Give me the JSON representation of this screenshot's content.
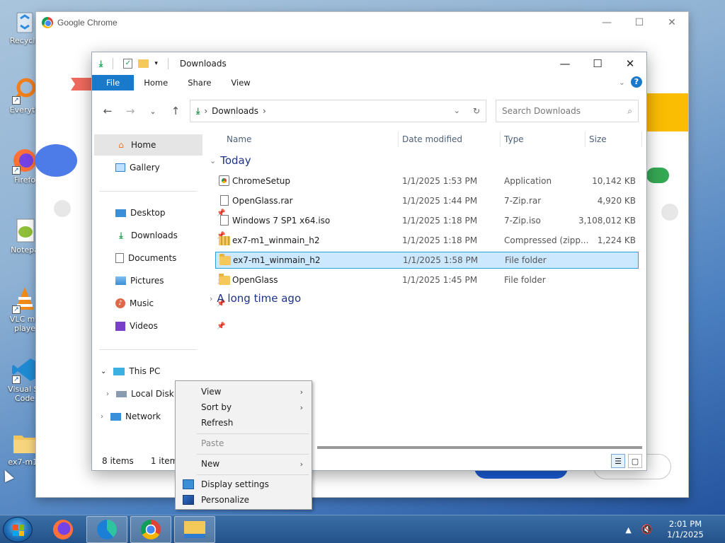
{
  "desktop": {
    "icons": [
      {
        "label": "Recycle",
        "icon": "recycle-bin-icon"
      },
      {
        "label": "Everyth",
        "icon": "everything-search-icon"
      },
      {
        "label": "Firefo",
        "icon": "firefox-icon"
      },
      {
        "label": "Notepa",
        "icon": "notepad-plus-icon"
      },
      {
        "label": "VLC me playe",
        "icon": "vlc-icon"
      },
      {
        "label": "Visual St Code",
        "icon": "vscode-icon"
      },
      {
        "label": "ex7-m1_",
        "icon": "folder-icon"
      }
    ]
  },
  "chrome": {
    "title": "Google Chrome",
    "controls": {
      "minimize": "—",
      "maximize": "☐",
      "close": "✕"
    }
  },
  "explorer": {
    "title": "Downloads",
    "controls": {
      "minimize": "—",
      "maximize": "☐",
      "close": "✕"
    },
    "ribbon": {
      "tabs": [
        "File",
        "Home",
        "Share",
        "View"
      ],
      "help": "?"
    },
    "address": {
      "root_separator": "›",
      "location": "Downloads",
      "trail_separator": "›"
    },
    "search": {
      "placeholder": "Search Downloads"
    },
    "sidebar": {
      "home": "Home",
      "gallery": "Gallery",
      "quick_access": [
        {
          "label": "Desktop",
          "icon": "desktop-icon"
        },
        {
          "label": "Downloads",
          "icon": "downloads-icon"
        },
        {
          "label": "Documents",
          "icon": "documents-icon"
        },
        {
          "label": "Pictures",
          "icon": "pictures-icon"
        },
        {
          "label": "Music",
          "icon": "music-icon"
        },
        {
          "label": "Videos",
          "icon": "videos-icon"
        }
      ],
      "this_pc": "This PC",
      "local_disk": "Local Disk",
      "network": "Network"
    },
    "columns": {
      "name": "Name",
      "date": "Date modified",
      "type": "Type",
      "size": "Size"
    },
    "groups": {
      "today": "Today",
      "older": "A long time ago"
    },
    "files": [
      {
        "name": "ChromeSetup",
        "date": "1/1/2025 1:53 PM",
        "type": "Application",
        "size": "10,142 KB",
        "icon": "setup"
      },
      {
        "name": "OpenGlass.rar",
        "date": "1/1/2025 1:44 PM",
        "type": "7-Zip.rar",
        "size": "4,920 KB",
        "icon": "doc"
      },
      {
        "name": "Windows 7 SP1 x64.iso",
        "date": "1/1/2025 1:18 PM",
        "type": "7-Zip.iso",
        "size": "3,108,012 KB",
        "icon": "doc"
      },
      {
        "name": "ex7-m1_winmain_h2",
        "date": "1/1/2025 1:18 PM",
        "type": "Compressed (zipp...",
        "size": "1,224 KB",
        "icon": "zip"
      },
      {
        "name": "ex7-m1_winmain_h2",
        "date": "1/1/2025 1:58 PM",
        "type": "File folder",
        "size": "",
        "icon": "folder",
        "selected": true
      },
      {
        "name": "OpenGlass",
        "date": "1/1/2025 1:45 PM",
        "type": "File folder",
        "size": "",
        "icon": "folder"
      }
    ],
    "status": {
      "count": "8 items",
      "selection": "1 item se"
    }
  },
  "context_menu": {
    "view": "View",
    "sort_by": "Sort by",
    "refresh": "Refresh",
    "paste": "Paste",
    "new": "New",
    "display_settings": "Display settings",
    "personalize": "Personalize"
  },
  "taskbar": {
    "apps": [
      "firefox",
      "edge",
      "chrome",
      "file-explorer"
    ],
    "time": "2:01 PM",
    "date": "1/1/2025"
  },
  "colors": {
    "accent": "#1979ca",
    "selection_bg": "#cce8ff",
    "selection_border": "#26a0da",
    "taskbar": "#24528a"
  }
}
